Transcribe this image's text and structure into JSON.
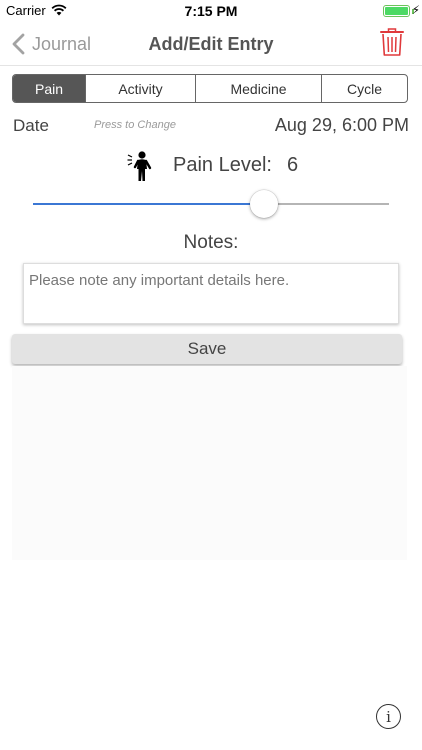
{
  "status_bar": {
    "carrier": "Carrier",
    "time": "7:15 PM"
  },
  "nav": {
    "back_label": "Journal",
    "title": "Add/Edit Entry",
    "back_icon": "chevron-left-icon",
    "delete_icon": "trash-icon"
  },
  "tabs": [
    {
      "label": "Pain",
      "active": true
    },
    {
      "label": "Activity",
      "active": false
    },
    {
      "label": "Medicine",
      "active": false
    },
    {
      "label": "Cycle",
      "active": false
    }
  ],
  "date": {
    "label": "Date",
    "hint": "Press to Change",
    "value": "Aug 29, 6:00 PM"
  },
  "pain": {
    "icon": "pain-person-icon",
    "label": "Pain Level:",
    "value": "6",
    "slider_fraction": 0.65
  },
  "notes": {
    "heading": "Notes:",
    "placeholder": "Please note any important details here.",
    "value": ""
  },
  "save_label": "Save",
  "info_icon": "info-icon",
  "colors": {
    "accent": "#3b77d4",
    "active_tab": "#565656",
    "delete": "#e0393b",
    "battery": "#4cd964"
  }
}
